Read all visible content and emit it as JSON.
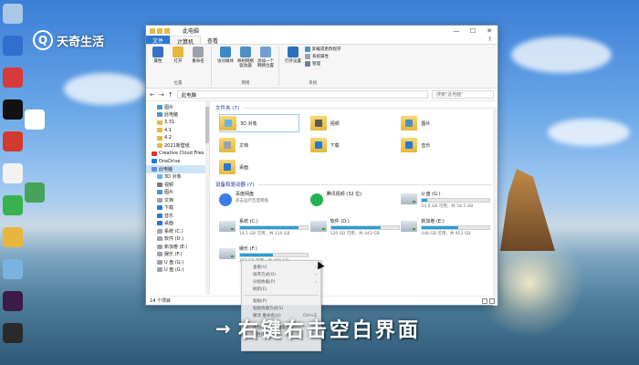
{
  "watermark": {
    "symbol": "Q",
    "text": "天奇生活"
  },
  "desktop_icons": [
    {
      "name": "recycle-bin",
      "label": "",
      "color": "#a9c8e8"
    },
    {
      "name": "app-blue",
      "label": "",
      "color": "#2e6fcf"
    },
    {
      "name": "app-red",
      "label": "",
      "color": "#d73a3a"
    },
    {
      "name": "app-music",
      "label": "",
      "color": "#111111"
    },
    {
      "name": "app-wps",
      "label": "",
      "color": "#d23a2e"
    },
    {
      "name": "app-qq",
      "label": "",
      "color": "#f2f2f2"
    },
    {
      "name": "app-wechat",
      "label": "",
      "color": "#37b24d"
    },
    {
      "name": "app-folder",
      "label": "",
      "color": "#e6b73c"
    },
    {
      "name": "app-photo",
      "label": "",
      "color": "#7bb3e0"
    },
    {
      "name": "app-adobe",
      "label": "",
      "color": "#3c1a4a"
    },
    {
      "name": "app-video",
      "label": "",
      "color": "#2a2a2a"
    },
    {
      "name": "app-file",
      "label": "",
      "color": "#ffffff"
    },
    {
      "name": "app-browser",
      "label": "",
      "color": "#46a35a"
    }
  ],
  "window": {
    "title": "此电脑",
    "controls": [
      "—",
      "☐",
      "✕"
    ],
    "tabs": [
      "文件",
      "计算机",
      "查看"
    ],
    "help": "?",
    "ribbon": {
      "location": {
        "label": "位置",
        "buttons": [
          {
            "label": "属性",
            "color": "#3a6fc4"
          },
          {
            "label": "打开",
            "color": "#e6b73c"
          },
          {
            "label": "重命名",
            "color": "#9aa3ad"
          }
        ]
      },
      "network": {
        "label": "网络",
        "buttons": [
          {
            "label": "访问媒体",
            "color": "#3c89c9"
          },
          {
            "label": "映射网络驱动器",
            "color": "#4f8fc7"
          },
          {
            "label": "添加一个网络位置",
            "color": "#6ea1cf"
          }
        ]
      },
      "system": {
        "label": "系统",
        "buttons": [
          {
            "label": "打开设置",
            "color": "#2b6fbf"
          }
        ],
        "small": [
          {
            "label": "卸载或更改程序",
            "color": "#4f8fc7"
          },
          {
            "label": "系统属性",
            "color": "#9aa3ad"
          },
          {
            "label": "管理",
            "color": "#6f7f91"
          }
        ]
      }
    },
    "address": {
      "back": "←",
      "forward": "→",
      "up": "↑",
      "path": "此电脑",
      "search_placeholder": "搜索\"此电脑\""
    },
    "nav": [
      {
        "label": "图片",
        "indent": true,
        "color": "#4f8fc7"
      },
      {
        "label": "此电脑",
        "indent": true,
        "color": "#5a8fd1"
      },
      {
        "label": "3.31",
        "indent": true,
        "color": "#e6b73c"
      },
      {
        "label": "4.1",
        "indent": true,
        "color": "#e6b73c"
      },
      {
        "label": "4.2",
        "indent": true,
        "color": "#e6b73c"
      },
      {
        "label": "2021新壁纸",
        "indent": true,
        "color": "#e6b73c"
      },
      {
        "label": "Creative Cloud Files",
        "indent": false,
        "color": "#da3a2a"
      },
      {
        "label": "OneDrive",
        "indent": false,
        "color": "#2b78d0"
      },
      {
        "label": "此电脑",
        "indent": false,
        "color": "#5a8fd1",
        "selected": true
      },
      {
        "label": "3D 对象",
        "indent": true,
        "color": "#63b3e6"
      },
      {
        "label": "视频",
        "indent": true,
        "color": "#7a7a7a"
      },
      {
        "label": "图片",
        "indent": true,
        "color": "#4f8fc7"
      },
      {
        "label": "文档",
        "indent": true,
        "color": "#9aa3ad"
      },
      {
        "label": "下载",
        "indent": true,
        "color": "#2b78d0"
      },
      {
        "label": "音乐",
        "indent": true,
        "color": "#2b78d0"
      },
      {
        "label": "桌面",
        "indent": true,
        "color": "#2b78d0"
      },
      {
        "label": "系统 (C:)",
        "indent": true,
        "color": "#9aa3ad"
      },
      {
        "label": "软件 (D:)",
        "indent": true,
        "color": "#9aa3ad"
      },
      {
        "label": "新加卷 (E:)",
        "indent": true,
        "color": "#9aa3ad"
      },
      {
        "label": "娱乐 (F:)",
        "indent": true,
        "color": "#9aa3ad"
      },
      {
        "label": "U 盘 (G:)",
        "indent": true,
        "color": "#9aa3ad"
      },
      {
        "label": "U 盘 (G:)",
        "indent": true,
        "color": "#9aa3ad"
      }
    ],
    "folders_header": "文件夹 (7)",
    "folders": [
      {
        "label": "3D 对象",
        "glyph": "#63b3e6",
        "selected": true
      },
      {
        "label": "视频",
        "glyph": "#5a5a5a"
      },
      {
        "label": "图片",
        "glyph": "#4f8fc7"
      },
      {
        "label": "文档",
        "glyph": "#9aa3ad"
      },
      {
        "label": "下载",
        "glyph": "#2b78d0"
      },
      {
        "label": "音乐",
        "glyph": "#2b78d0"
      },
      {
        "label": "桌面",
        "glyph": "#2b78d0"
      }
    ],
    "devices_header": "设备和驱动器 (7)",
    "devices": [
      {
        "name": "百度网盘",
        "sub": "双击运行百度网盘",
        "type": "app",
        "color": "#3b7de8"
      },
      {
        "name": "腾讯视频 (32 位)",
        "sub": "",
        "type": "app",
        "color": "#21b34f"
      },
      {
        "name": "U 盘 (G:)",
        "sub": "54.0 GB 可用，共 58.5 GB",
        "type": "drive",
        "usage": 0.08
      },
      {
        "name": "系统 (C:)",
        "sub": "14.5 GB 可用，共 110 GB",
        "type": "drive",
        "usage": 0.87
      },
      {
        "name": "软件 (D:)",
        "sub": "120 GB 可用，共 443 GB",
        "type": "drive",
        "usage": 0.73
      },
      {
        "name": "新加卷 (E:)",
        "sub": "448 GB 可用，共 953 GB",
        "type": "drive",
        "usage": 0.53
      },
      {
        "name": "娱乐 (F:)",
        "sub": "252 GB 可用，共 498 GB",
        "type": "drive",
        "usage": 0.49
      }
    ],
    "status": "14 个项目"
  },
  "context_menu": {
    "items": [
      {
        "label": "查看(V)",
        "arrow": true
      },
      {
        "label": "排序方式(O)",
        "arrow": true
      },
      {
        "label": "分组依据(P)",
        "arrow": true
      },
      {
        "label": "刷新(E)",
        "arrow": false
      },
      {
        "sep": true
      },
      {
        "label": "粘贴(P)",
        "arrow": false
      },
      {
        "label": "粘贴快捷方式(S)",
        "arrow": false
      },
      {
        "label": "撤消 重命名(U)",
        "arrow": false,
        "shortcut": "Ctrl+Z"
      },
      {
        "sep": true
      },
      {
        "label": "添加一个网络位置(L)",
        "arrow": false
      },
      {
        "label": "属性(R)",
        "arrow": false
      }
    ]
  },
  "caption": {
    "arrow": "→",
    "text": "右键右击空白界面"
  }
}
